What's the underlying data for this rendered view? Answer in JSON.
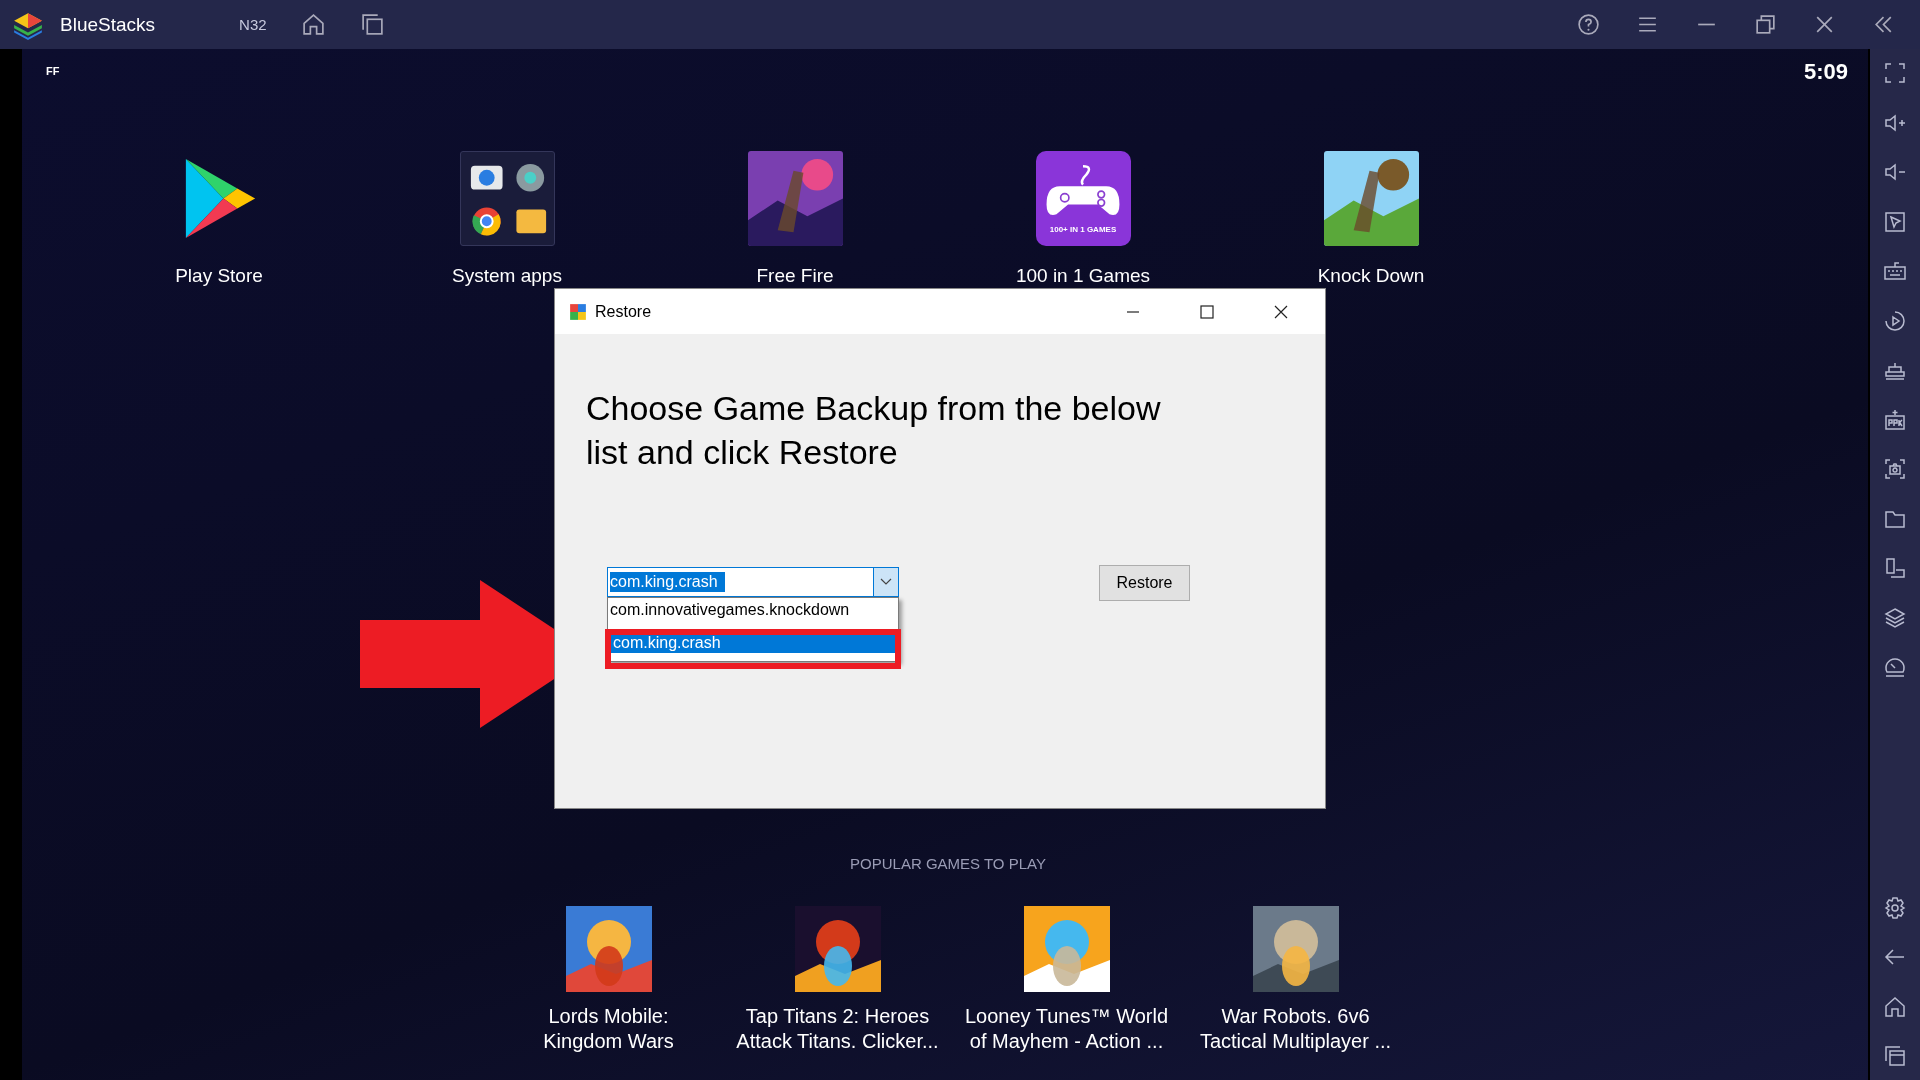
{
  "titlebar": {
    "app_name": "BlueStacks",
    "instance": "N32"
  },
  "status_bar": {
    "left": "FF",
    "time": "5:09"
  },
  "apps": [
    {
      "label": "Play Store",
      "kind": "play"
    },
    {
      "label": "System apps",
      "kind": "folder"
    },
    {
      "label": "Free Fire",
      "kind": "picture"
    },
    {
      "label": "100 in 1 Games",
      "kind": "games",
      "badge": "100+ IN 1 GAMES"
    },
    {
      "label": "Knock Down",
      "kind": "picture"
    }
  ],
  "dialog": {
    "title": "Restore",
    "heading": "Choose Game Backup from the below list and click Restore",
    "combo_value": "com.king.crash",
    "options": [
      {
        "label": "com.innovativegames.knockdown",
        "selected": false
      },
      {
        "label": "com.king.crash",
        "selected": true
      }
    ],
    "button": "Restore"
  },
  "popular": {
    "title": "POPULAR GAMES TO PLAY",
    "games": [
      {
        "lines": [
          "Lords Mobile:",
          "Kingdom Wars"
        ]
      },
      {
        "lines": [
          "Tap Titans 2: Heroes",
          "Attack Titans. Clicker..."
        ]
      },
      {
        "lines": [
          "Looney Tunes™ World",
          "of Mayhem - Action ..."
        ]
      },
      {
        "lines": [
          "War Robots. 6v6",
          "Tactical Multiplayer ..."
        ]
      }
    ]
  }
}
